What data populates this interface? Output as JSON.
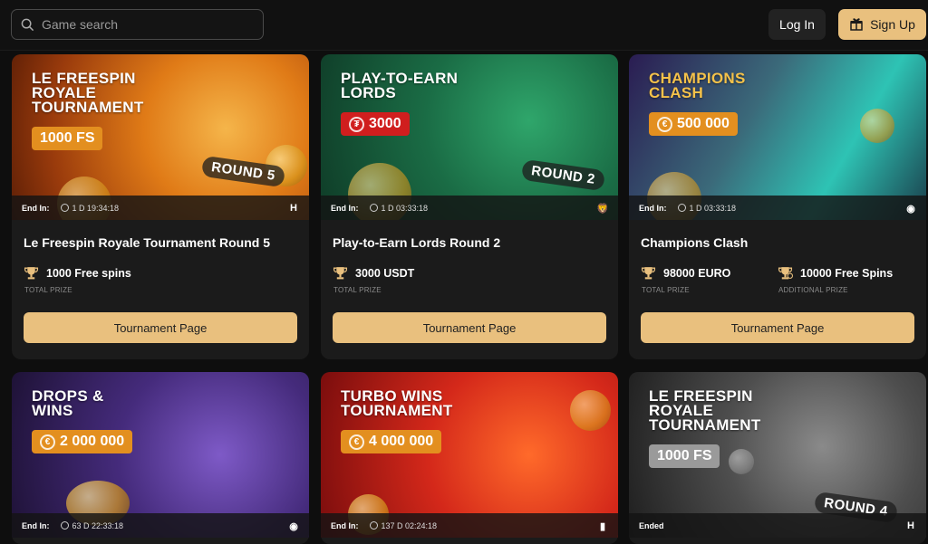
{
  "header": {
    "search_placeholder": "Game search",
    "login_label": "Log In",
    "signup_label": "Sign Up"
  },
  "colors": {
    "accent": "#e9c07e",
    "background": "#0e0e0e",
    "card": "#1b1b1b"
  },
  "tournaments": [
    {
      "banner_title": "Le Freespin\nRoyale\nTournament",
      "prize_pill": "1000 FS",
      "round_tag": "ROUND 5",
      "end_label": "End In:",
      "end_time": "1 D  19:34:18",
      "provider_logo": "H",
      "name": "Le Freespin Royale Tournament Round 5",
      "prizes": [
        {
          "value": "1000 Free spins",
          "label": "TOTAL PRIZE"
        }
      ],
      "button": "Tournament Page"
    },
    {
      "banner_title": "Play-to-Earn\nLords",
      "prize_pill": "3000",
      "pill_icon": "₮",
      "round_tag": "ROUND 2",
      "end_label": "End In:",
      "end_time": "1 D  03:33:18",
      "provider_logo": "🦁",
      "name": "Play-to-Earn Lords Round 2",
      "prizes": [
        {
          "value": "3000 USDT",
          "label": "TOTAL PRIZE"
        }
      ],
      "button": "Tournament Page"
    },
    {
      "banner_title": "Champions\nClash",
      "prize_pill": "500 000",
      "pill_icon": "€",
      "end_label": "End In:",
      "end_time": "1 D  03:33:18",
      "provider_logo": "◉",
      "name": "Champions Clash",
      "prizes": [
        {
          "value": "98000 EURO",
          "label": "TOTAL PRIZE"
        },
        {
          "value": "10000 Free Spins",
          "label": "ADDITIONAL PRIZE"
        }
      ],
      "button": "Tournament Page"
    },
    {
      "banner_title": "Drops &\nWins",
      "prize_pill": "2 000 000",
      "pill_icon": "€",
      "end_label": "End In:",
      "end_time": "63 D  22:33:18",
      "provider_logo": "◉"
    },
    {
      "banner_title": "Turbo Wins\nTournament",
      "prize_pill": "4 000 000",
      "pill_icon": "€",
      "end_label": "End In:",
      "end_time": "137 D  02:24:18",
      "provider_logo": "▮"
    },
    {
      "banner_title": "Le Freespin\nRoyale\nTournament",
      "prize_pill": "1000 FS",
      "round_tag": "ROUND 4",
      "end_label": "Ended",
      "provider_logo": "H"
    }
  ]
}
